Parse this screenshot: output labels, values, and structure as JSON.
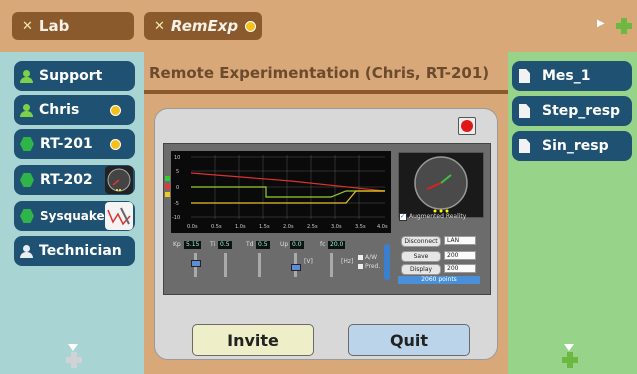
{
  "top_tabs": [
    {
      "label": "Lab",
      "has_status_dot": false
    },
    {
      "label": "RemExp",
      "has_status_dot": true
    }
  ],
  "left_nav": [
    {
      "label": "Support",
      "icon": "person-icon"
    },
    {
      "label": "Chris",
      "icon": "person-icon",
      "status_dot": true
    },
    {
      "label": "RT-201",
      "icon": "hexagon-icon",
      "status_dot": true
    },
    {
      "label": "RT-202",
      "icon": "hexagon-icon",
      "thumbnail": "camera-thumbnail"
    },
    {
      "label": "Sysquake",
      "icon": "hexagon-icon",
      "thumbnail": "graph-thumbnail"
    },
    {
      "label": "Technician",
      "icon": "person-icon"
    }
  ],
  "page_title": "Remote Experimentation (Chris, RT-201)",
  "experiment_panel": {
    "plot": {
      "y_ticks": [
        "10",
        "5",
        "0",
        "-5",
        "-10"
      ],
      "x_ticks": [
        "0.0s",
        "0.5s",
        "1.0s",
        "1.5s",
        "2.0s",
        "2.5s",
        "3.0s",
        "3.5s",
        "4.0s"
      ]
    },
    "augmented_reality_label": "Augmented Reality",
    "augmented_reality_checked": true,
    "params": [
      {
        "label": "Kp",
        "value": "5.15"
      },
      {
        "label": "Ti",
        "value": "0.5"
      },
      {
        "label": "Td",
        "value": "0.5"
      },
      {
        "label": "Up",
        "value": "0.0"
      },
      {
        "label": "fc",
        "value": "20.0"
      }
    ],
    "slider_labels": [
      "[V]",
      "[Hz]"
    ],
    "checkbox_labels": [
      "A/W",
      "Pred."
    ],
    "buttons": {
      "disconnect": "Disconnect",
      "save": "Save",
      "display": "Display"
    },
    "selects": {
      "connection": "LAN",
      "save_count": "200",
      "display_count": "200"
    },
    "points_label": "2060 points"
  },
  "actions": {
    "invite": "Invite",
    "quit": "Quit"
  },
  "right_list": [
    {
      "label": "Mes_1"
    },
    {
      "label": "Step_resp"
    },
    {
      "label": "Sin_resp"
    }
  ],
  "colors": {
    "background": "#d9a878",
    "nav_button": "#1f5272",
    "left_column": "#a9d4d4",
    "right_column": "#98d38a",
    "status_dot": "#f5c01e",
    "invite_button": "#eeeec8",
    "quit_button": "#bcd4ea"
  }
}
